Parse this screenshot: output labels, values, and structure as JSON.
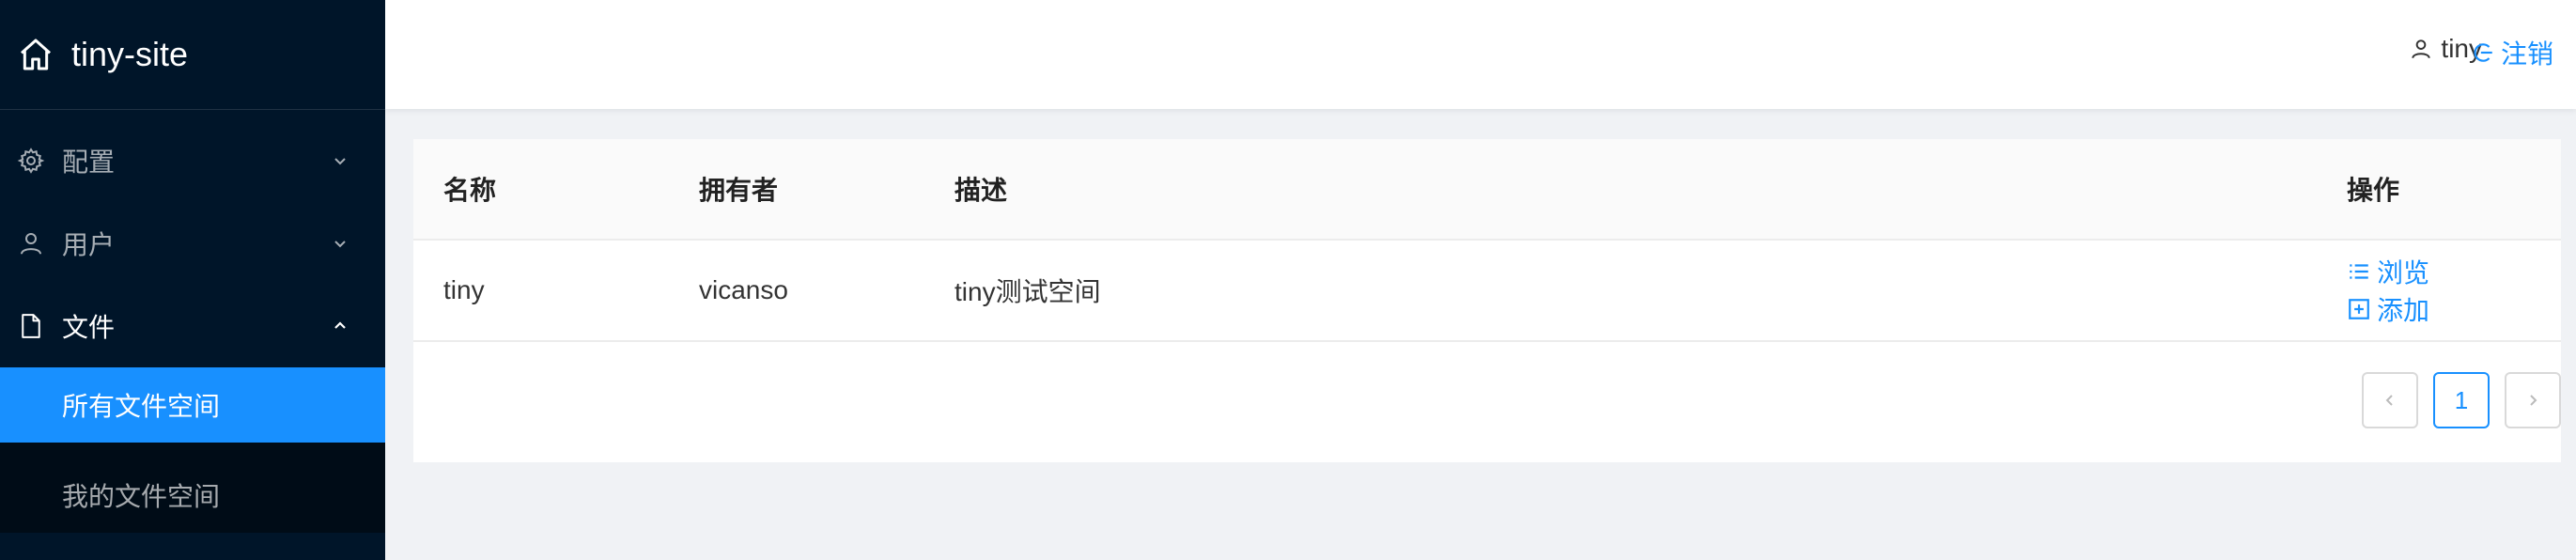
{
  "sidebar": {
    "brand": "tiny-site",
    "items": [
      {
        "label": "配置",
        "icon": "gear-icon",
        "expanded": false
      },
      {
        "label": "用户",
        "icon": "user-icon",
        "expanded": false
      },
      {
        "label": "文件",
        "icon": "file-icon",
        "expanded": true,
        "children": [
          {
            "label": "所有文件空间",
            "active": true
          },
          {
            "label": "我的文件空间",
            "active": false
          }
        ]
      }
    ]
  },
  "header": {
    "username": "tiny",
    "logout_label": "注销"
  },
  "table": {
    "columns": [
      "名称",
      "拥有者",
      "描述",
      "操作"
    ],
    "rows": [
      {
        "name": "tiny",
        "owner": "vicanso",
        "description": "tiny测试空间",
        "actions": [
          "浏览",
          "添加"
        ]
      }
    ]
  },
  "pagination": {
    "current": "1"
  },
  "colors": {
    "sidebar_bg": "#001529",
    "accent": "#1890ff",
    "submenu_bg": "#000c17"
  }
}
